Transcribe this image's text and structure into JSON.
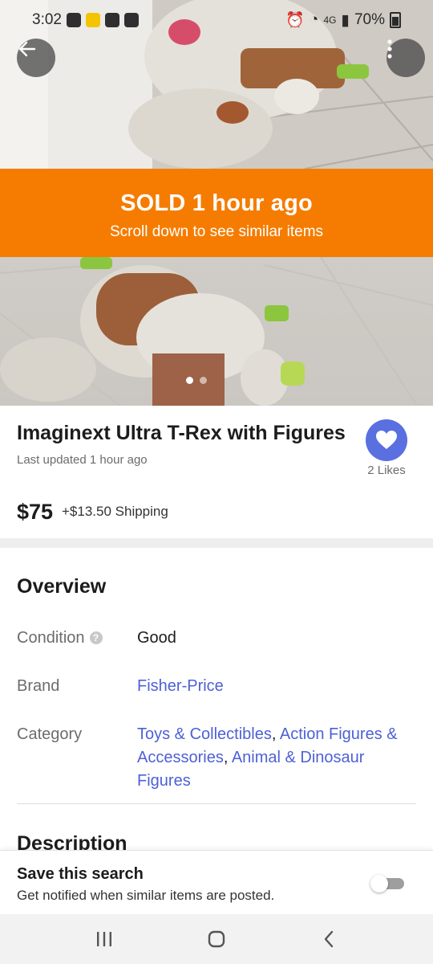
{
  "status_bar": {
    "time": "3:02",
    "network": "4G",
    "battery": "70%"
  },
  "hero": {
    "back_icon": "arrow-left-icon",
    "more_icon": "more-vertical-icon",
    "banner_title": "SOLD 1 hour ago",
    "banner_subtitle": "Scroll down to see similar items",
    "banner_color": "#f57c00",
    "photo_count": 2,
    "active_photo": 1
  },
  "listing": {
    "title": "Imaginext Ultra T-Rex with Figures",
    "updated": "Last updated 1 hour ago",
    "likes": "2 Likes",
    "like_color": "#5a6fe0",
    "price": "$75",
    "shipping": "+$13.50 Shipping"
  },
  "overview": {
    "heading": "Overview",
    "condition_label": "Condition",
    "condition_value": "Good",
    "brand_label": "Brand",
    "brand_value": "Fisher-Price",
    "category_label": "Category",
    "categories": [
      "Toys & Collectibles",
      "Action Figures & Accessories",
      "Animal & Dinosaur Figures"
    ],
    "link_color": "#4d61d6"
  },
  "description": {
    "heading": "Description"
  },
  "save_search": {
    "title": "Save this search",
    "subtitle": "Get notified when similar items are posted.",
    "toggle_on": false
  },
  "nav": {
    "recent_icon": "recent-apps-icon",
    "home_icon": "home-icon",
    "back_icon": "nav-back-icon"
  }
}
